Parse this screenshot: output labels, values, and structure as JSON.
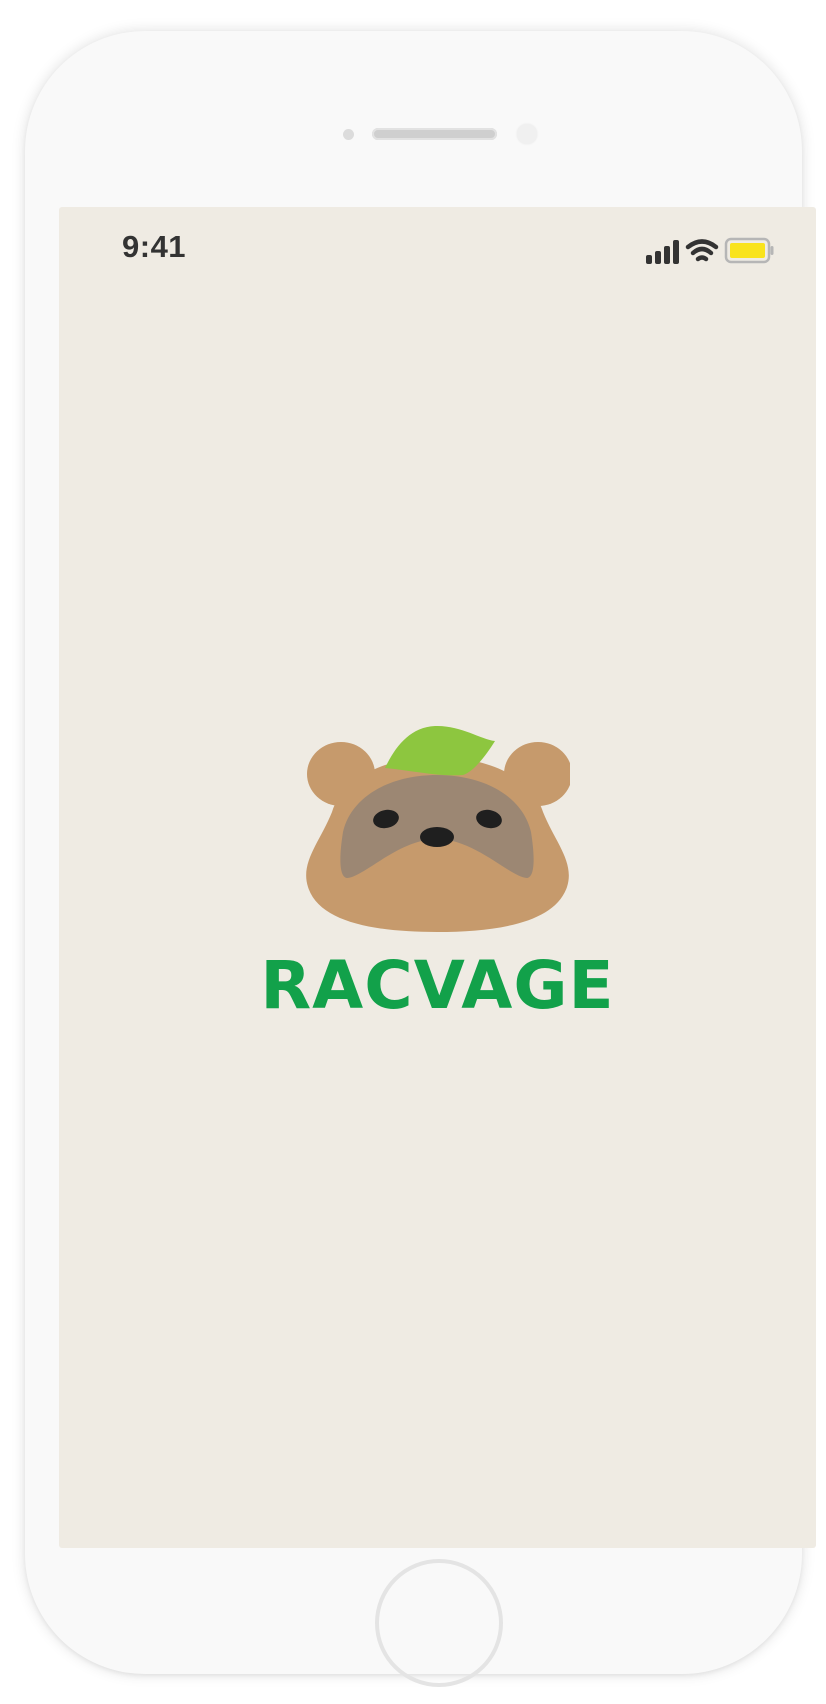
{
  "status_bar": {
    "time": "9:41",
    "signal_icon": "cellular-signal-icon",
    "wifi_icon": "wifi-icon",
    "battery_icon": "battery-icon",
    "battery_color": "#f9e31c"
  },
  "splash": {
    "logo_icon": "raccoon-leaf-logo-icon",
    "brand_name": "RACVAGE",
    "brand_color": "#12a14a",
    "background_color": "#efebe3"
  },
  "device": {
    "home_button_icon": "home-button"
  }
}
